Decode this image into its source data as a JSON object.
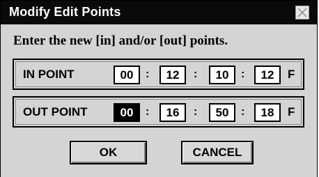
{
  "dialog": {
    "title": "Modify Edit Points",
    "close_icon": "close-icon",
    "prompt": "Enter the new [in] and/or [out] points."
  },
  "in_point": {
    "label": "IN POINT",
    "hours": "00",
    "minutes": "12",
    "seconds": "10",
    "frames": "12",
    "unit": "F"
  },
  "out_point": {
    "label": "OUT POINT",
    "hours": "00",
    "minutes": "16",
    "seconds": "50",
    "frames": "18",
    "unit": "F"
  },
  "separator": ":",
  "buttons": {
    "ok": "OK",
    "cancel": "CANCEL"
  },
  "colors": {
    "titlebar": "#0a0a0a",
    "dialog_bg": "#d4d4d4",
    "selected_field": "#000000"
  }
}
